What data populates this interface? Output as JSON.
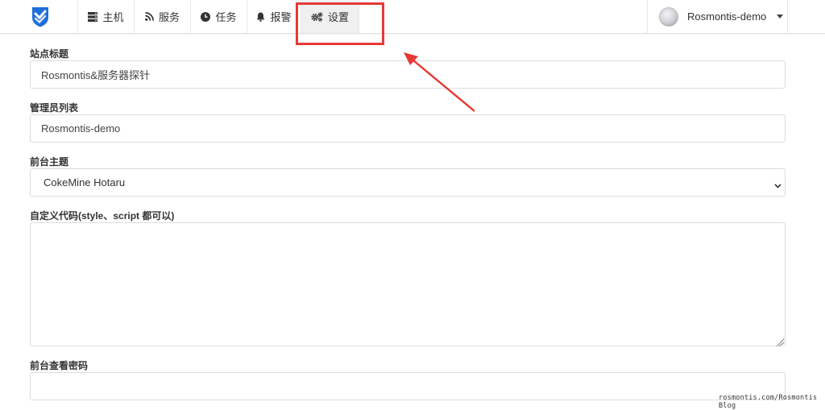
{
  "nav": {
    "items": [
      {
        "label": "主机",
        "icon": "server-icon"
      },
      {
        "label": "服务",
        "icon": "rss-icon"
      },
      {
        "label": "任务",
        "icon": "clock-icon"
      },
      {
        "label": "报警",
        "icon": "bell-icon"
      },
      {
        "label": "设置",
        "icon": "cogs-icon",
        "active": true
      }
    ],
    "user": {
      "name": "Rosmontis-demo"
    }
  },
  "form": {
    "site_title": {
      "label": "站点标题",
      "value": "Rosmontis&服务器探针"
    },
    "admin_list": {
      "label": "管理员列表",
      "value": "Rosmontis-demo"
    },
    "theme": {
      "label": "前台主题",
      "selected": "CokeMine Hotaru"
    },
    "custom_code": {
      "label": "自定义代码(style、script 都可以)",
      "value": ""
    },
    "view_password": {
      "label": "前台查看密码",
      "value": ""
    }
  },
  "annotation": {
    "color": "#e53935"
  },
  "watermark": "rosmontis.com/Rosmontis Blog",
  "colors": {
    "logo": "#1f6fd9",
    "active_nav_bg": "#f0f0f0",
    "border": "#dcdcdc"
  }
}
